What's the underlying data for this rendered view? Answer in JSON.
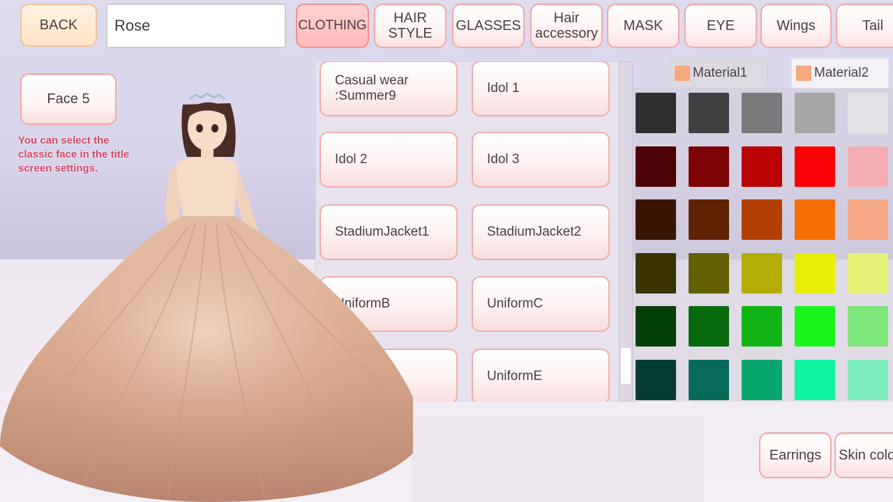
{
  "header": {
    "back_label": "BACK",
    "name_value": "Rose",
    "tabs": [
      {
        "label": "CLOTHING",
        "active": true
      },
      {
        "label": "HAIR\nSTYLE",
        "active": false
      },
      {
        "label": "GLASSES",
        "active": false
      },
      {
        "label": "Hair\naccessory",
        "active": false
      },
      {
        "label": "MASK",
        "active": false
      },
      {
        "label": "EYE",
        "active": false
      },
      {
        "label": "Wings",
        "active": false
      },
      {
        "label": "Tail",
        "active": false
      }
    ]
  },
  "face": {
    "button_label": "Face 5",
    "hint": "You can select the classic face in the title screen settings."
  },
  "clothing_list": [
    "Casual wear :Summer9",
    "Idol 1",
    "Idol 2",
    "Idol 3",
    "StadiumJacket1",
    "StadiumJacket2",
    "UniformB",
    "UniformC",
    "",
    "UniformE"
  ],
  "materials": {
    "tabs": [
      {
        "label": "Material1",
        "active": false
      },
      {
        "label": "Material2",
        "active": true
      }
    ],
    "selected_color": "#f7a97f"
  },
  "palette": [
    [
      "#2f2f31",
      "#414143",
      "#7a797b",
      "#a7a6a8",
      "#e4e2e6"
    ],
    [
      "#4d0206",
      "#7e0304",
      "#bb0304",
      "#f80204",
      "#f4aeb3"
    ],
    [
      "#3a1403",
      "#5f2303",
      "#b33f04",
      "#f56e03",
      "#f4a885"
    ],
    [
      "#3a3303",
      "#636003",
      "#b3ad05",
      "#e9ef04",
      "#e5ee75"
    ],
    [
      "#053f08",
      "#086a0f",
      "#10b414",
      "#19f61e",
      "#7fe77c"
    ],
    [
      "#043c33",
      "#086b5a",
      "#06a66d",
      "#10f5a2",
      "#7fefbe"
    ]
  ],
  "bottom_buttons": {
    "earrings_label": "Earrings",
    "skin_color_label": "Skin color"
  }
}
